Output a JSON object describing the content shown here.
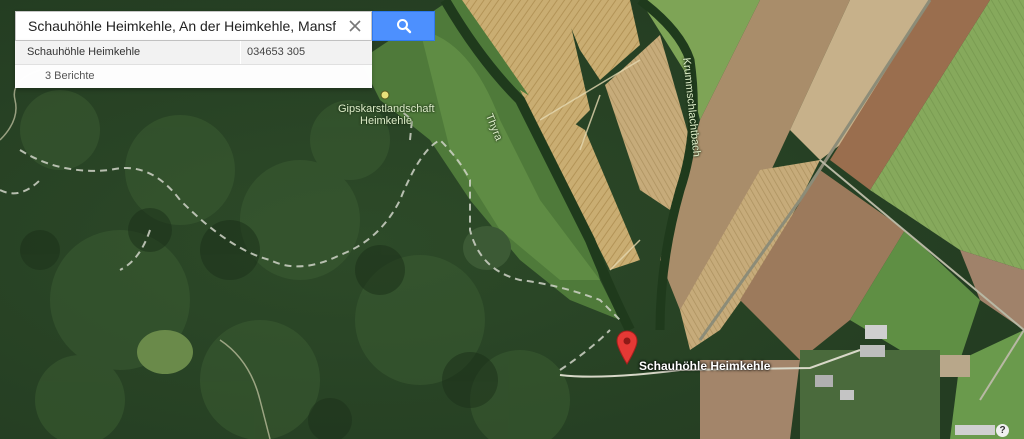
{
  "search": {
    "query": "Schauhöhle Heimkehle, An der Heimkehle, Mansfeld-S",
    "clear_icon": "close-icon",
    "search_icon": "search-icon",
    "button_color": "#4d90fe"
  },
  "suggestion": {
    "name": "Schauhöhle Heimkehle",
    "phone": "034653 305",
    "reviews": "3 Berichte"
  },
  "map": {
    "view": "satellite",
    "labels": {
      "poi_line1": "Gipskarstlandschaft",
      "poi_line2": "Heimkehle",
      "river_thyra": "Thyra",
      "river_krumm": "Krummschlachtbach",
      "place": "Schauhöhle Heimkehle"
    },
    "marker_icon": "map-pin-icon",
    "marker_color": "#e53935",
    "help_icon_glyph": "?"
  }
}
